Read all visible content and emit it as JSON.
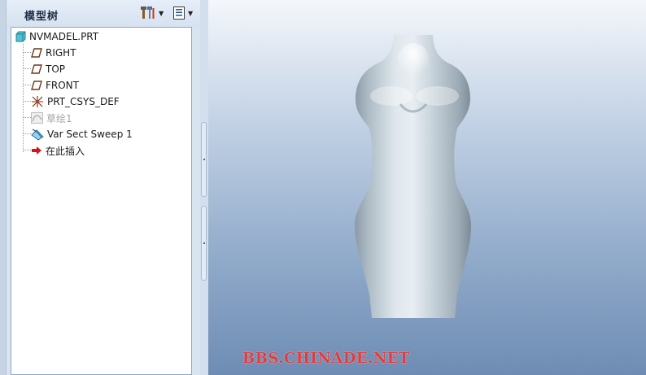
{
  "model_tree": {
    "title": "模型树",
    "settings_icon": "tools-icon",
    "show_icon": "list-icon",
    "items": [
      {
        "label": "NVMADEL.PRT",
        "icon": "part-icon"
      },
      {
        "label": "RIGHT",
        "icon": "datum-plane-icon"
      },
      {
        "label": "TOP",
        "icon": "datum-plane-icon"
      },
      {
        "label": "FRONT",
        "icon": "datum-plane-icon"
      },
      {
        "label": "PRT_CSYS_DEF",
        "icon": "csys-icon"
      },
      {
        "label": "草绘1",
        "icon": "sketch-icon",
        "hidden": true
      },
      {
        "label": "Var Sect Sweep 1",
        "icon": "sweep-icon"
      },
      {
        "label": "在此插入",
        "icon": "insert-arrow-icon"
      }
    ]
  },
  "viewport": {
    "watermark": "BBS.CHINADE.NET"
  },
  "colors": {
    "viewport_top": "#f4f7fb",
    "viewport_bottom": "#6e8cb4",
    "watermark": "#e33b3b",
    "insert_arrow": "#d01818",
    "datum_plane": "#6b3a1a"
  }
}
